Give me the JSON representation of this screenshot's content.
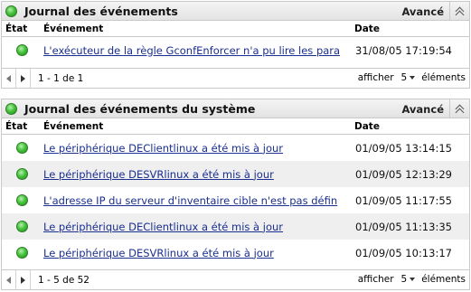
{
  "panels": [
    {
      "title": "Journal des événements",
      "advanced_label": "Avancé",
      "columns": {
        "state": "État",
        "event": "Événement",
        "date": "Date"
      },
      "rows": [
        {
          "event": "L'exécuteur de la règle GconfEnforcer n'a pu lire les para",
          "date": "31/08/05 17:19:54"
        }
      ],
      "footer": {
        "range": "1 - 1 de 1",
        "show_label": "afficher",
        "show_count": "5",
        "items_label": "éléments"
      }
    },
    {
      "title": "Journal des événements du système",
      "advanced_label": "Avancé",
      "columns": {
        "state": "État",
        "event": "Événement",
        "date": "Date"
      },
      "rows": [
        {
          "event": "Le périphérique DEClientlinux a été mis à jour",
          "date": "01/09/05 13:14:15"
        },
        {
          "event": "Le périphérique DESVRlinux a été mis à jour",
          "date": "01/09/05 12:13:29"
        },
        {
          "event": "L'adresse IP du serveur d'inventaire cible n'est pas défin",
          "date": "01/09/05 11:17:55"
        },
        {
          "event": "Le périphérique DEClientlinux a été mis à jour",
          "date": "01/09/05 11:13:35"
        },
        {
          "event": "Le périphérique DESVRlinux a été mis à jour",
          "date": "01/09/05 10:13:17"
        }
      ],
      "footer": {
        "range": "1 - 5 de 52",
        "show_label": "afficher",
        "show_count": "5",
        "items_label": "éléments"
      }
    }
  ],
  "icons": {
    "panel_status": "green-status-icon",
    "row_status": "green-status-icon",
    "collapse": "double-chevron-up-icon",
    "prev": "triangle-left-icon",
    "next": "triangle-right-icon",
    "dropdown": "triangle-down-icon"
  },
  "colors": {
    "status_green": "#47c43c",
    "link": "#1a2f8f",
    "row_shade": "#efefef",
    "border": "#c9c9c9"
  }
}
